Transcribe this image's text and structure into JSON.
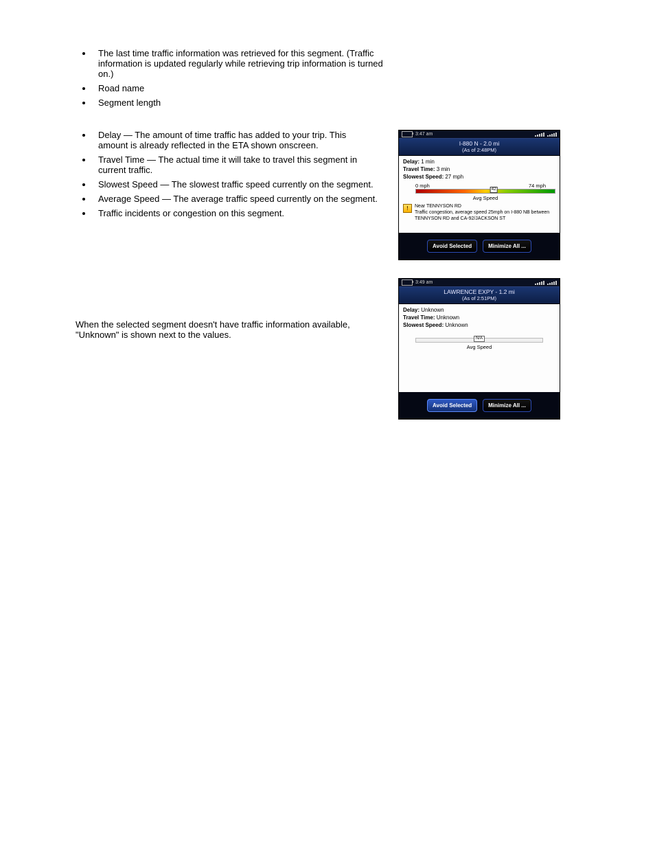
{
  "intro_list": {
    "items": [
      "The last time traffic information was retrieved for this segment. (Traffic information is updated regularly while retrieving trip information is turned on.)",
      "Road name",
      "Segment length"
    ]
  },
  "details": {
    "items": [
      "Delay — The amount of time traffic has added to your trip. This amount is already reflected in the ETA shown onscreen.",
      "Travel Time — The actual time it will take to travel this segment in current traffic.",
      "Slowest Speed — The slowest traffic speed currently on the segment.",
      "Average Speed — The average traffic speed currently on the segment.",
      "Traffic incidents or congestion on this segment."
    ]
  },
  "screenshot1": {
    "time_status": "3:47 am",
    "road": "I-880 N - 2.0 mi",
    "asof": "(As of 2:48PM)",
    "delay_label": "Delay:",
    "delay_value": "1 min",
    "travel_label": "Travel Time:",
    "travel_value": "3 min",
    "slow_label": "Slowest Speed:",
    "slow_value": "27 mph",
    "min_speed": "0 mph",
    "max_speed": "74 mph",
    "marker_value": "42",
    "avg_label": "Avg Speed",
    "inc_title": "Near TENNYSON RD",
    "inc_body": "Traffic congestion, average speed 25mph on I-880 NB between TENNYSON RD and CA-92/JACKSON ST",
    "btn_avoid": "Avoid Selected",
    "btn_min": "Minimize All ..."
  },
  "between_text": "When the selected segment doesn't have traffic information available, \"Unknown\" is shown next to the values.",
  "screenshot2": {
    "time_status": "3:49 am",
    "road": "LAWRENCE EXPY - 1.2 mi",
    "asof": "(As of 2:51PM)",
    "delay_label": "Delay:",
    "delay_value": "Unknown",
    "travel_label": "Travel Time:",
    "travel_value": "Unknown",
    "slow_label": "Slowest Speed:",
    "slow_value": "Unknown",
    "na_marker": "N/A",
    "avg_label": "Avg Speed",
    "btn_avoid": "Avoid Selected",
    "btn_min": "Minimize All ..."
  }
}
